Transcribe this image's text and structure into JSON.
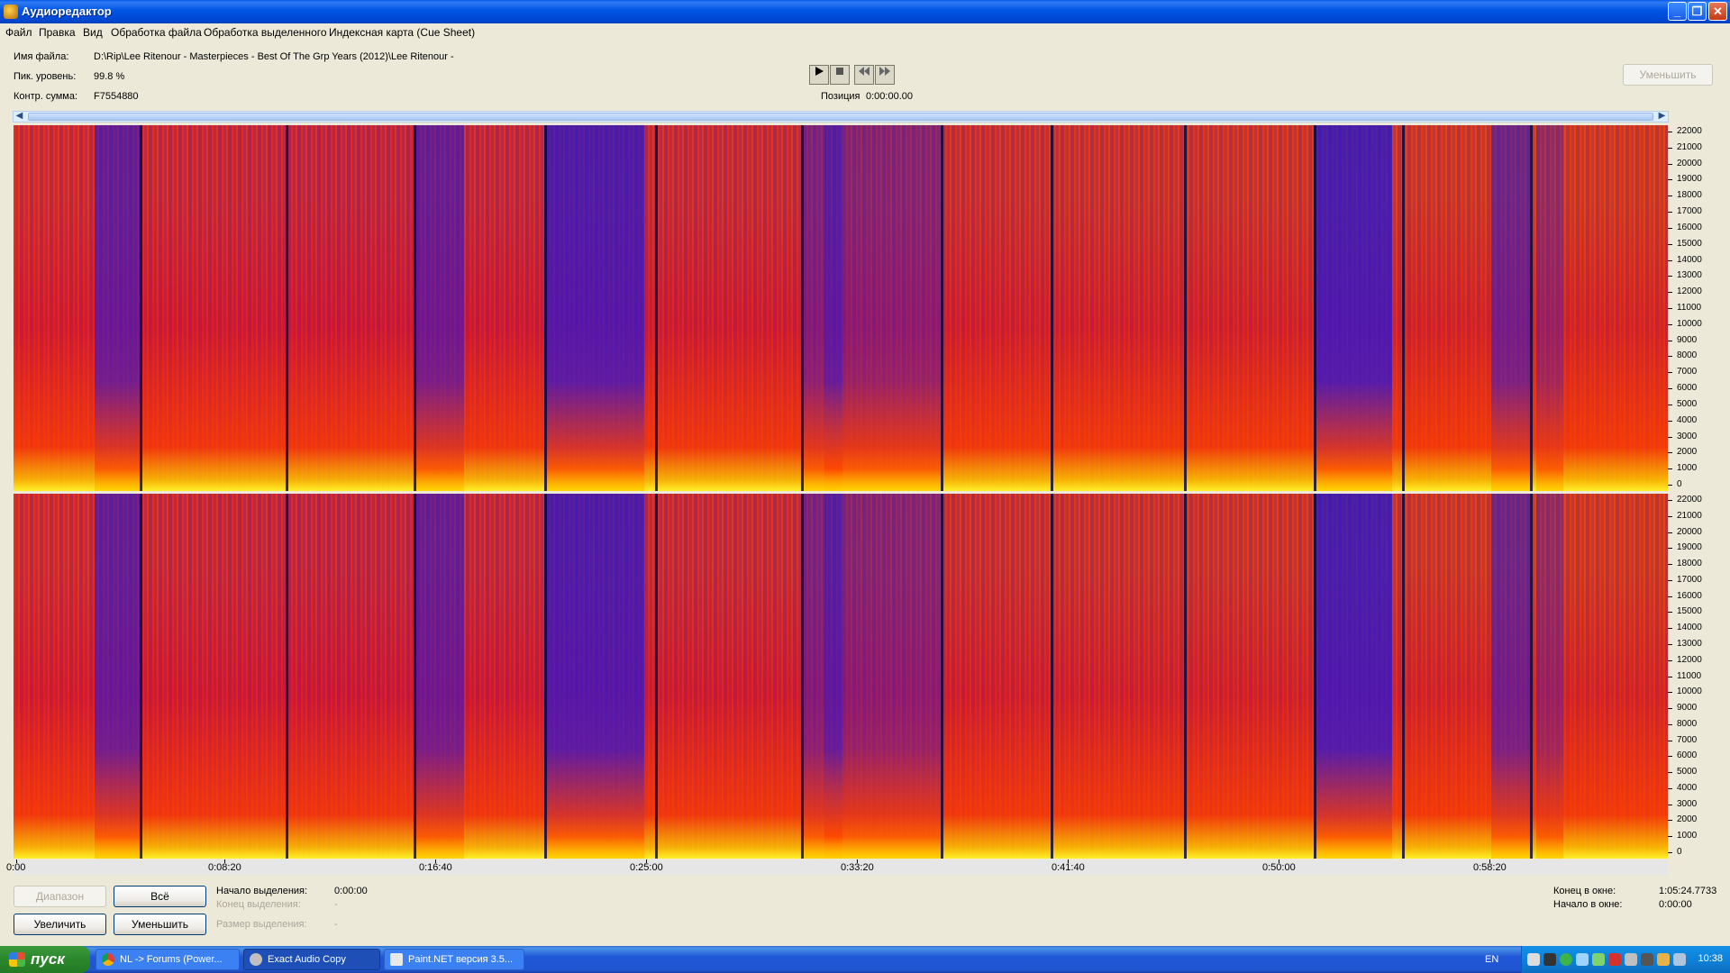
{
  "window": {
    "title": "Аудиоредактор",
    "controls": {
      "minimize": "_",
      "restore": "❐",
      "close": "✕"
    }
  },
  "menu": [
    "Файл",
    "Правка",
    "Вид",
    "Обработка файла",
    "Обработка выделенного",
    "Индексная карта (Cue Sheet)"
  ],
  "info": {
    "file_label": "Имя файла:",
    "file_value": "D:\\Rip\\Lee Ritenour - Masterpieces - Best Of The Grp Years (2012)\\Lee Ritenour -",
    "peak_label": "Пик. уровень:",
    "peak_value": "99.8 %",
    "crc_label": "Контр. сумма:",
    "crc_value": "F7554880"
  },
  "transport": {
    "play_icon": "play-icon",
    "stop_icon": "stop-icon",
    "prev_icon": "rewind-icon",
    "next_icon": "fast-forward-icon",
    "position_label": "Позиция",
    "position_value": "0:00:00.00"
  },
  "top_zoom_out": "Уменьшить",
  "spectrogram": {
    "y_ticks": [
      "22000",
      "21000",
      "20000",
      "19000",
      "18000",
      "17000",
      "16000",
      "15000",
      "14000",
      "13000",
      "12000",
      "11000",
      "10000",
      "9000",
      "8000",
      "7000",
      "6000",
      "5000",
      "4000",
      "3000",
      "2000",
      "1000",
      "0"
    ],
    "time_ticks": [
      "0:00",
      "0:08:20",
      "0:16:40",
      "0:25:00",
      "0:33:20",
      "0:41:40",
      "0:50:00",
      "0:58:20"
    ]
  },
  "bottom": {
    "range_button": "Диапазон",
    "all_button": "Всё",
    "zoom_in_button": "Увеличить",
    "zoom_out_button": "Уменьшить",
    "sel_start_label": "Начало выделения:",
    "sel_start_value": "0:00:00",
    "sel_end_label": "Конец выделения:",
    "sel_end_value": "-",
    "sel_size_label": "Размер выделения:",
    "sel_size_value": "-",
    "win_end_label": "Конец в окне:",
    "win_end_value": "1:05:24.7733",
    "win_start_label": "Начало в окне:",
    "win_start_value": "0:00:00"
  },
  "taskbar": {
    "start": "пуск",
    "tasks": [
      "NL -> Forums (Power...",
      "Exact Audio Copy",
      "Paint.NET версия 3.5..."
    ],
    "lang": "EN",
    "clock": "10:38"
  }
}
